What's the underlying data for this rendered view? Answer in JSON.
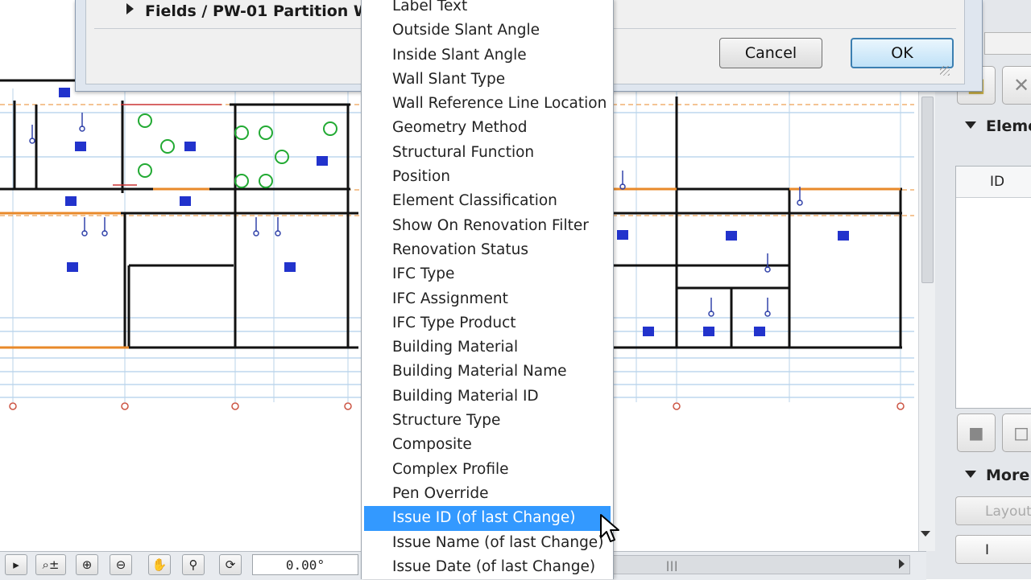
{
  "dialog": {
    "tree_row": "Fields / PW-01 Partition W",
    "cancel_label": "Cancel",
    "ok_label": "OK"
  },
  "dropdown": {
    "items": [
      "Label Text",
      "Outside Slant Angle",
      "Inside Slant Angle",
      "Wall Slant Type",
      "Wall Reference Line Location",
      "Geometry Method",
      "Structural Function",
      "Position",
      "Element Classification",
      "Show On Renovation Filter",
      "Renovation Status",
      "IFC Type",
      "IFC Assignment",
      "IFC Type Product",
      "Building Material",
      "Building Material Name",
      "Building Material ID",
      "Structure Type",
      "Composite",
      "Complex Profile",
      "Pen Override",
      "Issue ID (of last Change)",
      "Issue Name (of last Change)",
      "Issue Date (of last Change)"
    ],
    "selected_index": 21
  },
  "right_panel": {
    "section_elements": "Eleme",
    "table_header_id": "ID",
    "section_more": "More",
    "layout_button": "Layout",
    "bottom_button": "I"
  },
  "toolbar": {
    "angle_value": "0.00°"
  },
  "colors": {
    "selection": "#3399ff",
    "ok_border": "#3c7fb1",
    "wall_orange": "#e8892a",
    "symbol_blue": "#2233cc",
    "fixture_green": "#22aa33",
    "dim_red": "#cc3333"
  }
}
